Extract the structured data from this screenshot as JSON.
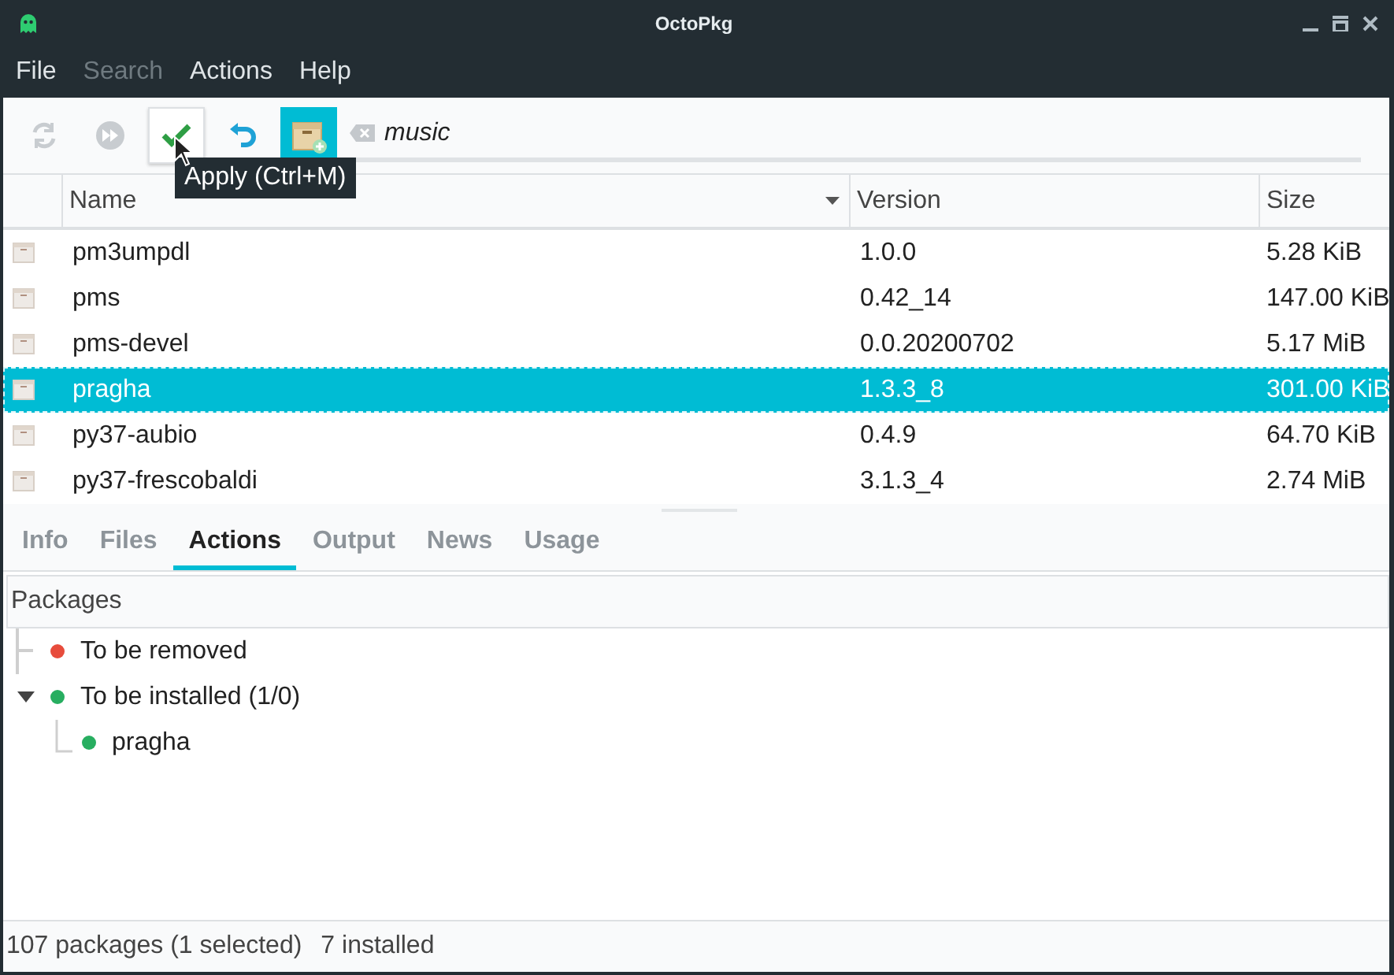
{
  "window": {
    "title": "OctoPkg"
  },
  "menu": [
    {
      "label": "File",
      "disabled": false
    },
    {
      "label": "Search",
      "disabled": true
    },
    {
      "label": "Actions",
      "disabled": false
    },
    {
      "label": "Help",
      "disabled": false
    }
  ],
  "toolbar": [
    {
      "kind": "sync",
      "disabled": true,
      "hovered": false,
      "checked": false
    },
    {
      "kind": "forward",
      "disabled": true,
      "hovered": false,
      "checked": false
    },
    {
      "kind": "apply",
      "disabled": false,
      "hovered": true,
      "checked": false
    },
    {
      "kind": "undo",
      "disabled": false,
      "hovered": false,
      "checked": false
    },
    {
      "kind": "install",
      "disabled": false,
      "hovered": false,
      "checked": true
    }
  ],
  "search": {
    "value": "music"
  },
  "tooltip": "Apply (Ctrl+M)",
  "table": {
    "columns": [
      "Name",
      "Version",
      "Size"
    ],
    "rows": [
      {
        "name": "pm3umpdl",
        "version": "1.0.0",
        "size": "5.28 KiB",
        "selected": false
      },
      {
        "name": "pms",
        "version": "0.42_14",
        "size": "147.00 KiB",
        "selected": false
      },
      {
        "name": "pms-devel",
        "version": "0.0.20200702",
        "size": "5.17 MiB",
        "selected": false
      },
      {
        "name": "pragha",
        "version": "1.3.3_8",
        "size": "301.00 KiB",
        "selected": true
      },
      {
        "name": "py37-aubio",
        "version": "0.4.9",
        "size": "64.70 KiB",
        "selected": false
      },
      {
        "name": "py37-frescobaldi",
        "version": "3.1.3_4",
        "size": "2.74 MiB",
        "selected": false
      }
    ]
  },
  "tabs": [
    {
      "label": "Info",
      "selected": false
    },
    {
      "label": "Files",
      "selected": false
    },
    {
      "label": "Actions",
      "selected": true
    },
    {
      "label": "Output",
      "selected": false
    },
    {
      "label": "News",
      "selected": false
    },
    {
      "label": "Usage",
      "selected": false
    }
  ],
  "actions": {
    "header": "Packages",
    "items": [
      {
        "label": "To be removed",
        "color": "#e74c3c",
        "expanded": false
      },
      {
        "label": "To be installed (1/0)",
        "color": "#27ae60",
        "expanded": true,
        "children": [
          {
            "label": "pragha",
            "color": "#27ae60"
          }
        ]
      }
    ]
  },
  "status_bar": {
    "packages": "107 packages (1 selected)",
    "installed": "7 installed"
  }
}
